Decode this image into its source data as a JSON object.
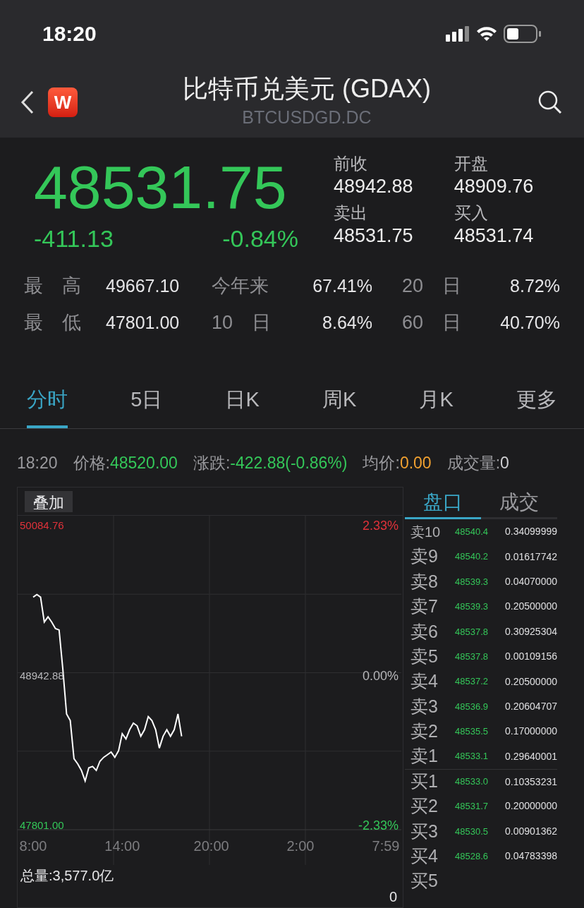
{
  "status_bar": {
    "time": "18:20"
  },
  "nav": {
    "title": "比特币兑美元 (GDAX)",
    "subtitle": "BTCUSDGD.DC",
    "logo": "W"
  },
  "quote": {
    "price": "48531.75",
    "change": "-411.13",
    "change_pct": "-0.84%",
    "fields": [
      {
        "label": "前收",
        "value": "48942.88"
      },
      {
        "label": "开盘",
        "value": "48909.76"
      },
      {
        "label": "卖出",
        "value": "48531.75"
      },
      {
        "label": "买入",
        "value": "48531.74"
      }
    ]
  },
  "stats": [
    [
      {
        "label": "最　高",
        "value": "49667.10"
      },
      {
        "label": "今年来",
        "value": "67.41%"
      },
      {
        "label": "20　日",
        "value": "8.72%"
      }
    ],
    [
      {
        "label": "最　低",
        "value": "47801.00"
      },
      {
        "label": "10　日",
        "value": "8.64%"
      },
      {
        "label": "60　日",
        "value": "40.70%"
      }
    ]
  ],
  "tabs": [
    {
      "label": "分时",
      "selected": true
    },
    {
      "label": "5日",
      "selected": false
    },
    {
      "label": "日K",
      "selected": false
    },
    {
      "label": "周K",
      "selected": false
    },
    {
      "label": "月K",
      "selected": false
    },
    {
      "label": "更多",
      "selected": false
    }
  ],
  "info_line": [
    {
      "label": "18:20",
      "kind": "time"
    },
    {
      "label": "价格:",
      "value": "48520.00",
      "kind": "up"
    },
    {
      "label": "涨跌:",
      "value": "-422.88(-0.86%)",
      "kind": "up"
    },
    {
      "label": "均价:",
      "value": "0.00",
      "kind": "avg"
    },
    {
      "label": "成交量:",
      "value": "0",
      "kind": "plain"
    }
  ],
  "overlay_button": "叠加",
  "chart": {
    "chart_data": {
      "type": "line",
      "categories": [
        "8:00",
        null,
        null,
        null,
        null,
        null,
        null,
        null,
        null,
        null,
        null,
        null,
        null,
        null,
        null,
        null,
        null,
        null,
        null,
        null,
        null,
        null,
        null,
        null,
        "14:00",
        null,
        null,
        null,
        null,
        null,
        null,
        null,
        null,
        null,
        null,
        null,
        null,
        null,
        null,
        null,
        null,
        null,
        null,
        null,
        null,
        null,
        null,
        null,
        "20:00",
        null,
        null,
        null,
        null,
        null,
        null,
        null,
        null,
        null,
        null,
        null,
        null,
        null,
        null,
        null,
        null,
        null,
        null,
        null,
        null,
        null,
        null,
        null,
        "2:00",
        null,
        null,
        null,
        null,
        null,
        null,
        null,
        null,
        null,
        null,
        null,
        null,
        null,
        null,
        null,
        null,
        null,
        null,
        null,
        null,
        null,
        null,
        "7:59"
      ],
      "series": [
        {
          "color": "#ffffff",
          "values": [
            49540,
            49560,
            49540,
            49350,
            49390,
            49350,
            49300,
            49290,
            48990,
            48650,
            48600,
            48310,
            48270,
            48220,
            48140,
            48240,
            48250,
            48220,
            48290,
            48320,
            48340,
            48360,
            48320,
            48370,
            48500,
            48460,
            48530,
            48580,
            48560,
            48480,
            48530,
            48630,
            48600,
            48530,
            48390,
            48480,
            48530,
            48480,
            48530,
            48650,
            48480,
            null,
            null,
            null,
            null,
            null,
            null,
            null,
            null,
            null,
            null,
            null,
            null,
            null,
            null,
            null,
            null,
            null,
            null,
            null,
            null,
            null,
            null,
            null,
            null,
            null,
            null,
            null,
            null,
            null,
            null,
            null,
            null,
            null,
            null,
            null,
            null,
            null,
            null,
            null,
            null,
            null,
            null,
            null,
            null,
            null,
            null,
            null,
            null,
            null,
            null,
            null,
            null,
            null,
            null,
            null
          ]
        }
      ],
      "ylim": [
        47801.0,
        50084.76
      ],
      "yticks": [
        {
          "value": 50084.76,
          "label": "50084.76"
        },
        {
          "value": 48942.88,
          "label": "48942.88"
        },
        {
          "value": 47801.0,
          "label": "47801.00"
        }
      ]
    },
    "right_ticks": [
      "2.33%",
      "0.00%",
      "-2.33%"
    ]
  },
  "total_volume": "总量:3,577.0亿",
  "volume_reading": "0",
  "book_tabs": [
    {
      "label": "盘口",
      "selected": true
    },
    {
      "label": "成交",
      "selected": false
    }
  ],
  "order_book": [
    {
      "label": "卖10",
      "price": "48540.4",
      "volume": "0.34099999"
    },
    {
      "label": "卖9",
      "price": "48540.2",
      "volume": "0.01617742"
    },
    {
      "label": "卖8",
      "price": "48539.3",
      "volume": "0.04070000"
    },
    {
      "label": "卖7",
      "price": "48539.3",
      "volume": "0.20500000"
    },
    {
      "label": "卖6",
      "price": "48537.8",
      "volume": "0.30925304"
    },
    {
      "label": "卖5",
      "price": "48537.8",
      "volume": "0.00109156"
    },
    {
      "label": "卖4",
      "price": "48537.2",
      "volume": "0.20500000"
    },
    {
      "label": "卖3",
      "price": "48536.9",
      "volume": "0.20604707"
    },
    {
      "label": "卖2",
      "price": "48535.5",
      "volume": "0.17000000"
    },
    {
      "label": "卖1",
      "price": "48533.1",
      "volume": "0.29640001"
    },
    {
      "label": "买1",
      "price": "48533.0",
      "volume": "0.10353231"
    },
    {
      "label": "买2",
      "price": "48531.7",
      "volume": "0.20000000"
    },
    {
      "label": "买3",
      "price": "48530.5",
      "volume": "0.00901362"
    },
    {
      "label": "买4",
      "price": "48528.6",
      "volume": "0.04783398"
    },
    {
      "label": "买5"
    }
  ]
}
